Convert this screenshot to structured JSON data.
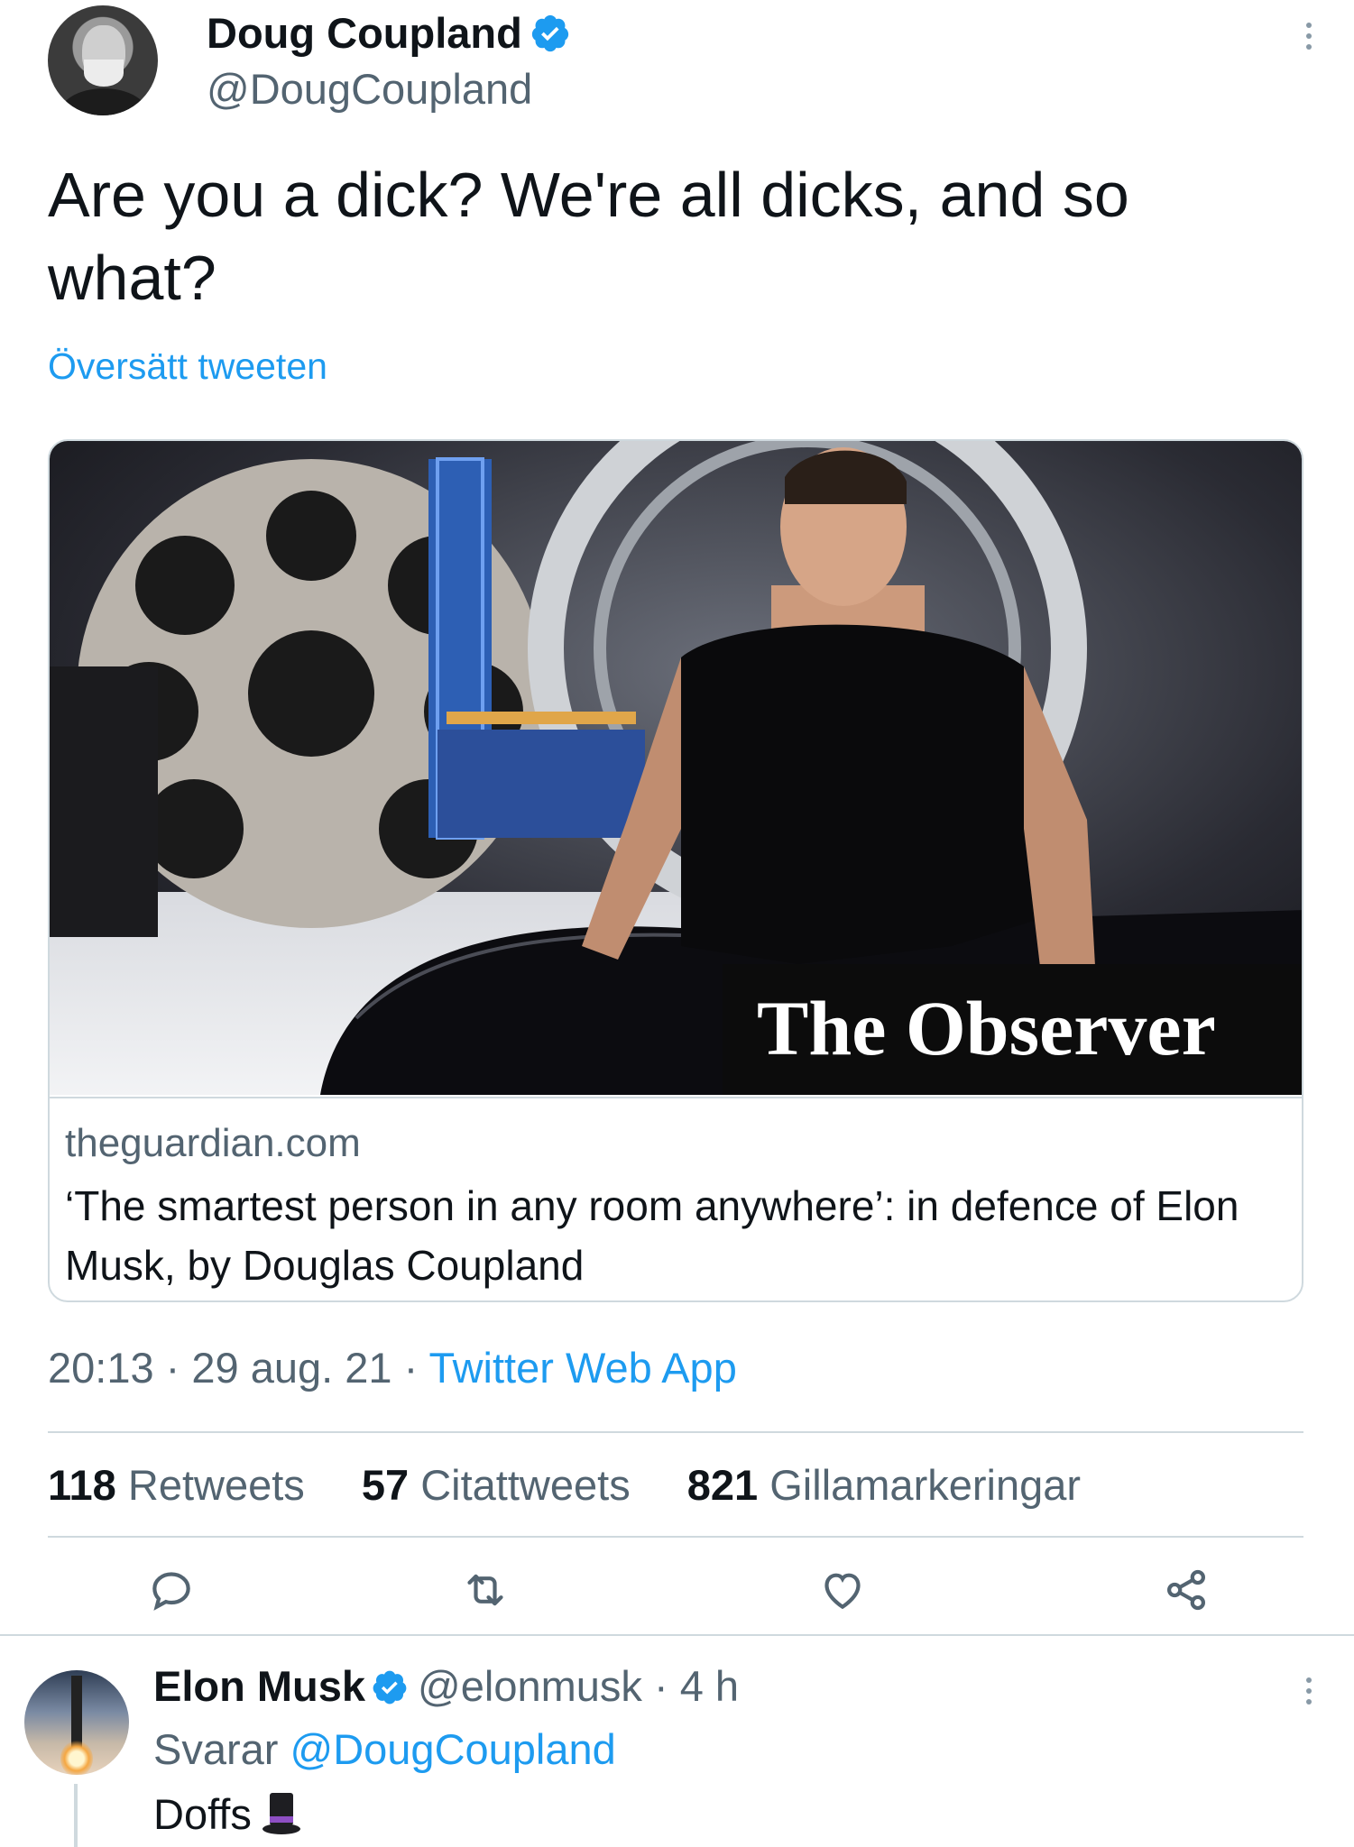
{
  "tweet": {
    "author_name": "Doug Coupland",
    "author_handle": "@DougCoupland",
    "text": "Are you a dick? We're all dicks, and so what?",
    "translate_label": "Översätt tweeten",
    "card": {
      "image_caption": "The Observer",
      "domain": "theguardian.com",
      "title": "‘The smartest person in any room anywhere’: in defence of Elon Musk, by Douglas Coupland"
    },
    "time": "20:13",
    "date": "29 aug. 21",
    "source": "Twitter Web App",
    "stats": [
      {
        "count": "118",
        "label": "Retweets"
      },
      {
        "count": "57",
        "label": "Citattweets"
      },
      {
        "count": "821",
        "label": "Gillamarkeringar"
      }
    ],
    "actions": [
      "reply-icon",
      "retweet-icon",
      "like-icon",
      "share-icon"
    ]
  },
  "reply": {
    "author_name": "Elon Musk",
    "author_handle": "@elonmusk",
    "age": "4 h",
    "replying_prefix": "Svarar",
    "replying_to": "@DougCoupland",
    "text": "Doffs"
  },
  "colors": {
    "accent": "#1d9bf0",
    "secondary_text": "#536471",
    "divider": "#cfd9de"
  }
}
